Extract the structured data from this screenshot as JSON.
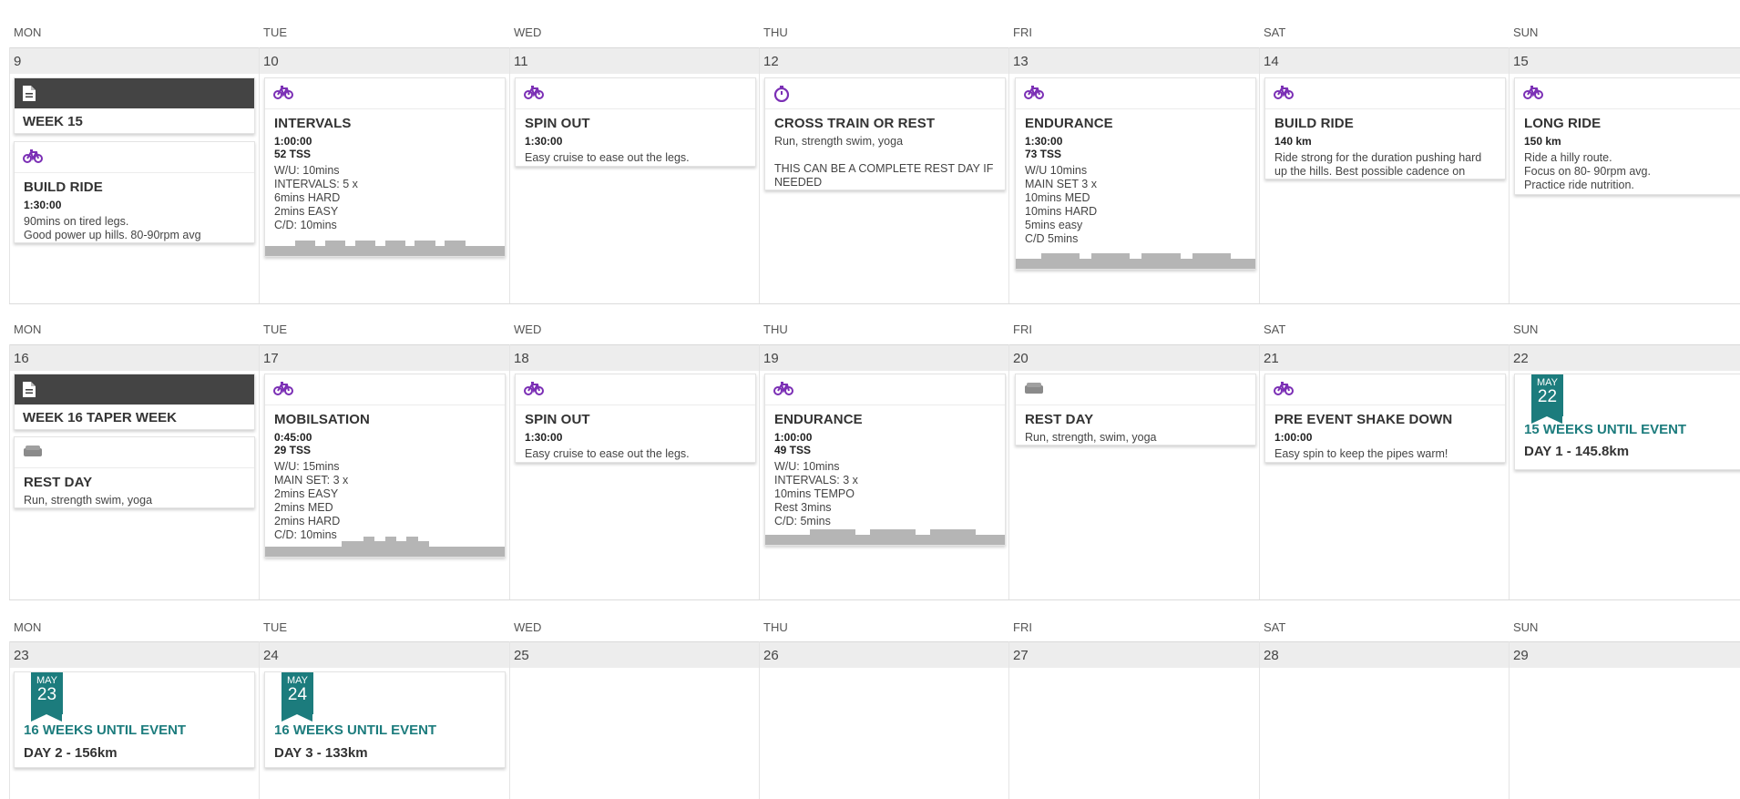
{
  "colors": {
    "accent": "#1c7c7d",
    "icon": "#7b2fb5",
    "dark_header": "#444444"
  },
  "weeks": [
    {
      "day_names": [
        "MON",
        "TUE",
        "WED",
        "THU",
        "FRI",
        "SAT",
        "SUN"
      ],
      "day_numbers": [
        "9",
        "10",
        "11",
        "12",
        "13",
        "14",
        "15"
      ],
      "week_label": "WEEK 15",
      "cards": {
        "mon": {
          "icon": "bike-icon",
          "title": "BUILD RIDE",
          "duration": "1:30:00",
          "desc": "90mins on tired legs.\nGood power up hills. 80-90rpm avg"
        },
        "tue": {
          "icon": "bike-icon",
          "title": "INTERVALS",
          "duration": "1:00:00",
          "tss": "52 TSS",
          "desc": "W/U: 10mins\nINTERVALS: 5 x\n6mins HARD\n2mins EASY\nC/D: 10mins"
        },
        "wed": {
          "icon": "bike-icon",
          "title": "SPIN OUT",
          "duration": "1:30:00",
          "desc": "Easy cruise to ease out the legs."
        },
        "thu": {
          "icon": "stopwatch-icon",
          "title": "CROSS TRAIN OR REST",
          "desc": "Run, strength swim, yoga\n\nTHIS CAN BE A COMPLETE REST DAY IF NEEDED"
        },
        "fri": {
          "icon": "bike-icon",
          "title": "ENDURANCE",
          "duration": "1:30:00",
          "tss": "73 TSS",
          "desc": "W/U 10mins\nMAIN SET 3 x\n10mins MED\n10mins HARD\n5mins easy\nC/D 5mins"
        },
        "sat": {
          "icon": "bike-icon",
          "title": "BUILD RIDE",
          "duration": "140 km",
          "desc": "Ride strong for the duration pushing hard up the hills. Best possible cadence on climbs."
        },
        "sun": {
          "icon": "bike-icon",
          "title": "LONG RIDE",
          "duration": "150 km",
          "desc": "Ride a hilly route.\nFocus on 80- 90rpm avg.\nPractice ride nutrition."
        }
      }
    },
    {
      "day_names": [
        "MON",
        "TUE",
        "WED",
        "THU",
        "FRI",
        "SAT",
        "SUN"
      ],
      "day_numbers": [
        "16",
        "17",
        "18",
        "19",
        "20",
        "21",
        "22"
      ],
      "week_label": "WEEK 16 TAPER WEEK",
      "cards": {
        "mon": {
          "icon": "rest-icon",
          "title": "REST DAY",
          "desc": "Run, strength swim, yoga"
        },
        "tue": {
          "icon": "bike-icon",
          "title": "MOBILSATION",
          "duration": "0:45:00",
          "tss": "29 TSS",
          "desc": "W/U: 15mins\nMAIN SET: 3 x\n2mins EASY\n2mins MED\n2mins HARD\nC/D: 10mins"
        },
        "wed": {
          "icon": "bike-icon",
          "title": "SPIN OUT",
          "duration": "1:30:00",
          "desc": "Easy cruise to ease out the legs."
        },
        "thu": {
          "icon": "bike-icon",
          "title": "ENDURANCE",
          "duration": "1:00:00",
          "tss": "49 TSS",
          "desc": "W/U: 10mins\nINTERVALS: 3 x\n10mins TEMPO\nRest 3mins\nC/D: 5mins"
        },
        "fri": {
          "icon": "rest-icon",
          "title": "REST DAY",
          "desc": "Run, strength, swim, yoga"
        },
        "sat": {
          "icon": "bike-icon",
          "title": "PRE EVENT SHAKE DOWN",
          "duration": "1:00:00",
          "desc": "Easy spin to keep the pipes warm!"
        },
        "sun": {
          "flag_month": "MAY",
          "flag_day": "22",
          "weeks_until": "15 WEEKS UNTIL EVENT",
          "event_day": "DAY 1 - 145.8km"
        }
      }
    },
    {
      "day_names": [
        "MON",
        "TUE",
        "WED",
        "THU",
        "FRI",
        "SAT",
        "SUN"
      ],
      "day_numbers": [
        "23",
        "24",
        "25",
        "26",
        "27",
        "28",
        "29"
      ],
      "cards": {
        "mon": {
          "flag_month": "MAY",
          "flag_day": "23",
          "weeks_until": "16 WEEKS UNTIL EVENT",
          "event_day": "DAY 2 - 156km"
        },
        "tue": {
          "flag_month": "MAY",
          "flag_day": "24",
          "weeks_until": "16 WEEKS UNTIL EVENT",
          "event_day": "DAY 3 - 133km"
        }
      }
    }
  ],
  "workout_profiles": {
    "intervals": [
      2,
      2,
      2,
      3,
      3,
      2,
      3,
      3,
      2,
      3,
      3,
      2,
      3,
      3,
      2,
      3,
      3,
      2,
      3,
      3,
      2,
      2,
      2,
      2
    ],
    "endurance_w1": [
      2,
      2,
      3,
      3,
      3,
      2,
      3,
      3,
      3,
      2,
      3,
      3,
      3,
      2,
      3,
      3,
      3,
      2,
      2
    ],
    "mobilisation": [
      2,
      2,
      2,
      2,
      2,
      2,
      2,
      3,
      3,
      4,
      3,
      4,
      3,
      4,
      3,
      2,
      2,
      2,
      2,
      2,
      2,
      2
    ],
    "endurance_w2": [
      2,
      2,
      2,
      3,
      3,
      3,
      2,
      3,
      3,
      3,
      2,
      3,
      3,
      3,
      2,
      2
    ]
  }
}
